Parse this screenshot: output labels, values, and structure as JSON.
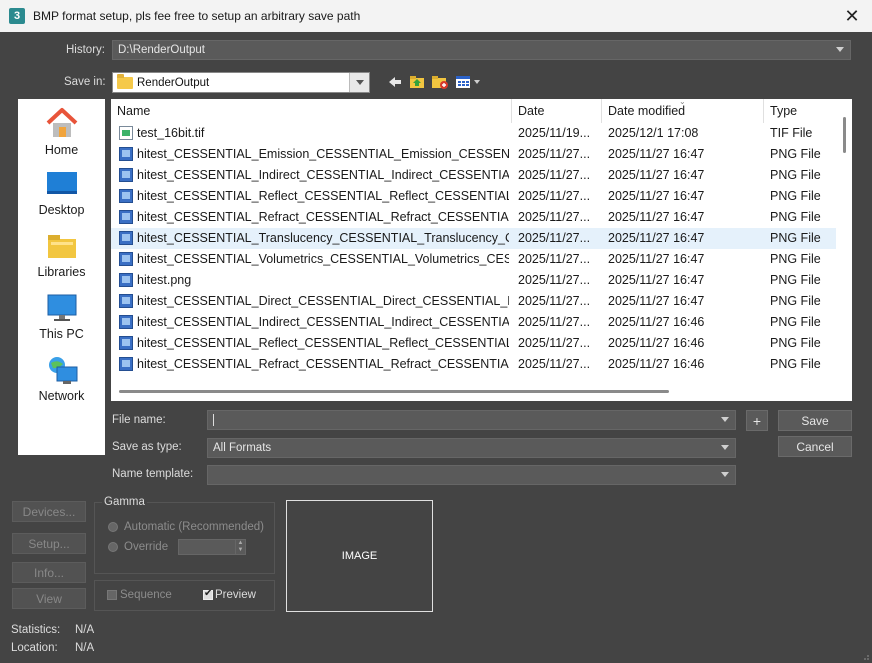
{
  "window": {
    "title": "BMP format setup, pls fee free to setup an arbitrary save path",
    "app_icon": "3"
  },
  "history": {
    "label": "History:",
    "value": "D:\\RenderOutput"
  },
  "save_in": {
    "label": "Save in:",
    "label_shortcut": "i",
    "value": "RenderOutput"
  },
  "places": [
    {
      "label": "Home",
      "icon": "home-icon"
    },
    {
      "label": "Desktop",
      "icon": "desktop-icon"
    },
    {
      "label": "Libraries",
      "icon": "libraries-icon"
    },
    {
      "label": "This PC",
      "icon": "pc-icon"
    },
    {
      "label": "Network",
      "icon": "network-icon"
    }
  ],
  "columns": {
    "name": "Name",
    "date": "Date",
    "modified": "Date modified",
    "type": "Type"
  },
  "files": [
    {
      "name": "test_16bit.tif",
      "date": "2025/11/19...",
      "modified": "2025/12/1 17:08",
      "type": "TIF File",
      "kind": "tif"
    },
    {
      "name": "hitest_CESSENTIAL_Emission_CESSENTIAL_Emission_CESSENTI...",
      "date": "2025/11/27...",
      "modified": "2025/11/27 16:47",
      "type": "PNG File",
      "kind": "png"
    },
    {
      "name": "hitest_CESSENTIAL_Indirect_CESSENTIAL_Indirect_CESSENTIAL_...",
      "date": "2025/11/27...",
      "modified": "2025/11/27 16:47",
      "type": "PNG File",
      "kind": "png"
    },
    {
      "name": "hitest_CESSENTIAL_Reflect_CESSENTIAL_Reflect_CESSENTIAL_R...",
      "date": "2025/11/27...",
      "modified": "2025/11/27 16:47",
      "type": "PNG File",
      "kind": "png"
    },
    {
      "name": "hitest_CESSENTIAL_Refract_CESSENTIAL_Refract_CESSENTIAL_...",
      "date": "2025/11/27...",
      "modified": "2025/11/27 16:47",
      "type": "PNG File",
      "kind": "png"
    },
    {
      "name": "hitest_CESSENTIAL_Translucency_CESSENTIAL_Translucency_CE...",
      "date": "2025/11/27...",
      "modified": "2025/11/27 16:47",
      "type": "PNG File",
      "kind": "png",
      "selected": true
    },
    {
      "name": "hitest_CESSENTIAL_Volumetrics_CESSENTIAL_Volumetrics_CES...",
      "date": "2025/11/27...",
      "modified": "2025/11/27 16:47",
      "type": "PNG File",
      "kind": "png"
    },
    {
      "name": "hitest.png",
      "date": "2025/11/27...",
      "modified": "2025/11/27 16:47",
      "type": "PNG File",
      "kind": "png"
    },
    {
      "name": "hitest_CESSENTIAL_Direct_CESSENTIAL_Direct_CESSENTIAL_Dir...",
      "date": "2025/11/27...",
      "modified": "2025/11/27 16:47",
      "type": "PNG File",
      "kind": "png"
    },
    {
      "name": "hitest_CESSENTIAL_Indirect_CESSENTIAL_Indirect_CESSENTIAL_...",
      "date": "2025/11/27...",
      "modified": "2025/11/27 16:46",
      "type": "PNG File",
      "kind": "png"
    },
    {
      "name": "hitest_CESSENTIAL_Reflect_CESSENTIAL_Reflect_CESSENTIAL_R...",
      "date": "2025/11/27...",
      "modified": "2025/11/27 16:46",
      "type": "PNG File",
      "kind": "png"
    },
    {
      "name": "hitest_CESSENTIAL_Refract_CESSENTIAL_Refract_CESSENTIAL_...",
      "date": "2025/11/27...",
      "modified": "2025/11/27 16:46",
      "type": "PNG File",
      "kind": "png"
    }
  ],
  "file_name": {
    "label": "File name:",
    "value": ""
  },
  "save_as_type": {
    "label": "Save as type:",
    "value": "All Formats"
  },
  "name_template": {
    "label": "Name template:",
    "value": ""
  },
  "buttons": {
    "plus": "+",
    "save": "Save",
    "cancel": "Cancel",
    "devices": "Devices...",
    "setup": "Setup...",
    "info": "Info...",
    "view": "View"
  },
  "gamma": {
    "title": "Gamma",
    "automatic": "Automatic (Recommended)",
    "override": "Override"
  },
  "options": {
    "sequence": "Sequence",
    "preview": "Preview",
    "preview_checked": true
  },
  "image_placeholder": "IMAGE",
  "statistics": {
    "label": "Statistics:",
    "value": "N/A"
  },
  "location": {
    "label": "Location:",
    "value": "N/A"
  }
}
